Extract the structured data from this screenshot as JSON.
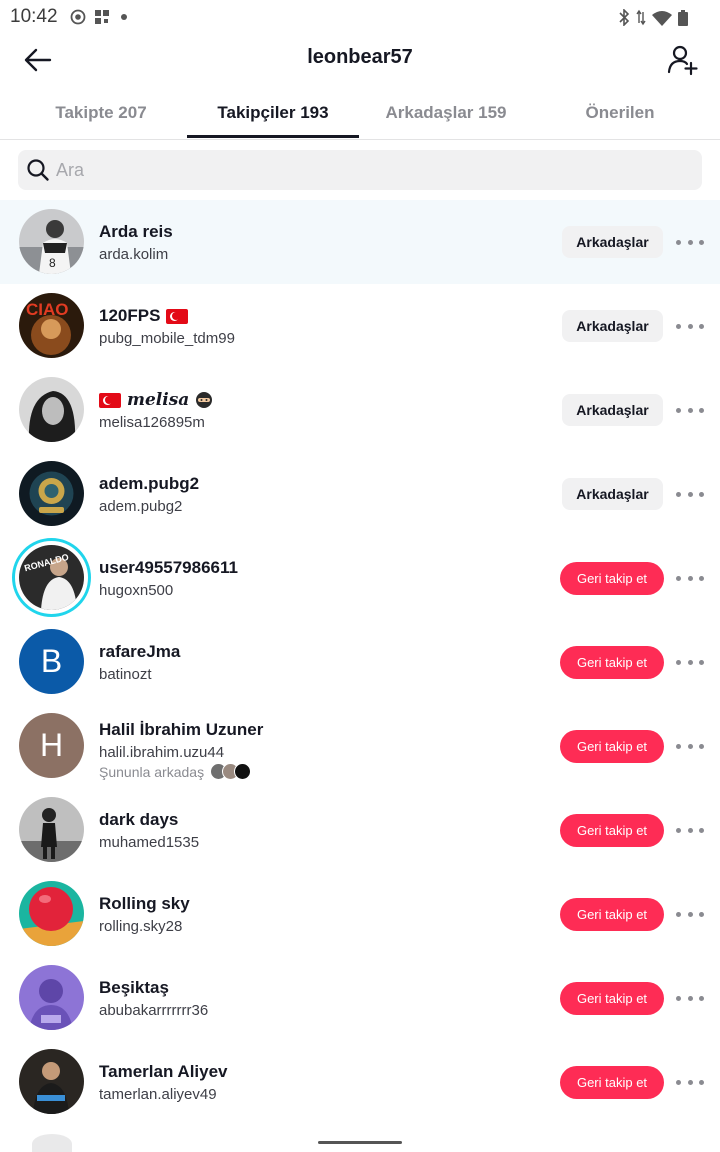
{
  "status_bar": {
    "time": "10:42"
  },
  "header": {
    "title": "leonbear57",
    "back_icon": "arrow-left-icon",
    "add_icon": "add-user-icon"
  },
  "tabs": [
    {
      "label": "Takipte 207",
      "active": false
    },
    {
      "label": "Takipçiler 193",
      "active": true
    },
    {
      "label": "Arkadaşlar 159",
      "active": false
    },
    {
      "label": "Önerilen",
      "active": false
    }
  ],
  "search": {
    "placeholder": "Ara",
    "value": ""
  },
  "users": [
    {
      "name": "Arda reis",
      "handle": "arda.kolim",
      "action": "Arkadaşlar",
      "highlight": true,
      "avatar_color": "#6b6e73",
      "name_icon": ""
    },
    {
      "name": "120FPS",
      "handle": "pubg_mobile_tdm99",
      "action": "Arkadaşlar",
      "avatar_color": "#5b3a1e",
      "name_icon": "turkey-flag-icon"
    },
    {
      "name": "melisa",
      "handle": "melisa126895m",
      "action": "Arkadaşlar",
      "avatar_color": "#9a9a9a",
      "name_icon": "turkey-flag-icon",
      "name_suffix_icon": "ninja-emoji-icon"
    },
    {
      "name": "adem.pubg2",
      "handle": "adem.pubg2",
      "action": "Arkadaşlar",
      "avatar_color": "#1e2f3a",
      "name_icon": ""
    },
    {
      "name": "user49557986611",
      "handle": "hugoxn500",
      "action": "Geri takip et",
      "avatar_color": "#2b2b2b",
      "story_ring": true,
      "name_icon": ""
    },
    {
      "name": "rafareJma",
      "handle": "batinozt",
      "action": "Geri takip et",
      "avatar_color": "#0b5aa8",
      "avatar_letter": "B",
      "name_icon": ""
    },
    {
      "name": "Halil İbrahim Uzuner",
      "handle": "halil.ibrahim.uzu44",
      "action": "Geri takip et",
      "avatar_color": "#8c7164",
      "avatar_letter": "H",
      "mutual": "Şununla arkadaş",
      "name_icon": ""
    },
    {
      "name": "dark days",
      "handle": "muhamed1535",
      "action": "Geri takip et",
      "avatar_color": "#4a4a4a",
      "name_icon": ""
    },
    {
      "name": "Rolling sky",
      "handle": "rolling.sky28",
      "action": "Geri takip et",
      "avatar_color": "#1bb5a0",
      "name_icon": ""
    },
    {
      "name": "Beşiktaş",
      "handle": "abubakarrrrrrr36",
      "action": "Geri takip et",
      "avatar_color": "#7b5ec9",
      "name_icon": ""
    },
    {
      "name": "Tamerlan Aliyev",
      "handle": "tamerlan.aliyev49",
      "action": "Geri takip et",
      "avatar_color": "#2a2622",
      "name_icon": ""
    }
  ],
  "colors": {
    "follow_back": "#fe2c55",
    "friends_button_bg": "#f1f1f2",
    "story_ring": "#20d5ec",
    "highlight_row": "#f3f9fc"
  }
}
